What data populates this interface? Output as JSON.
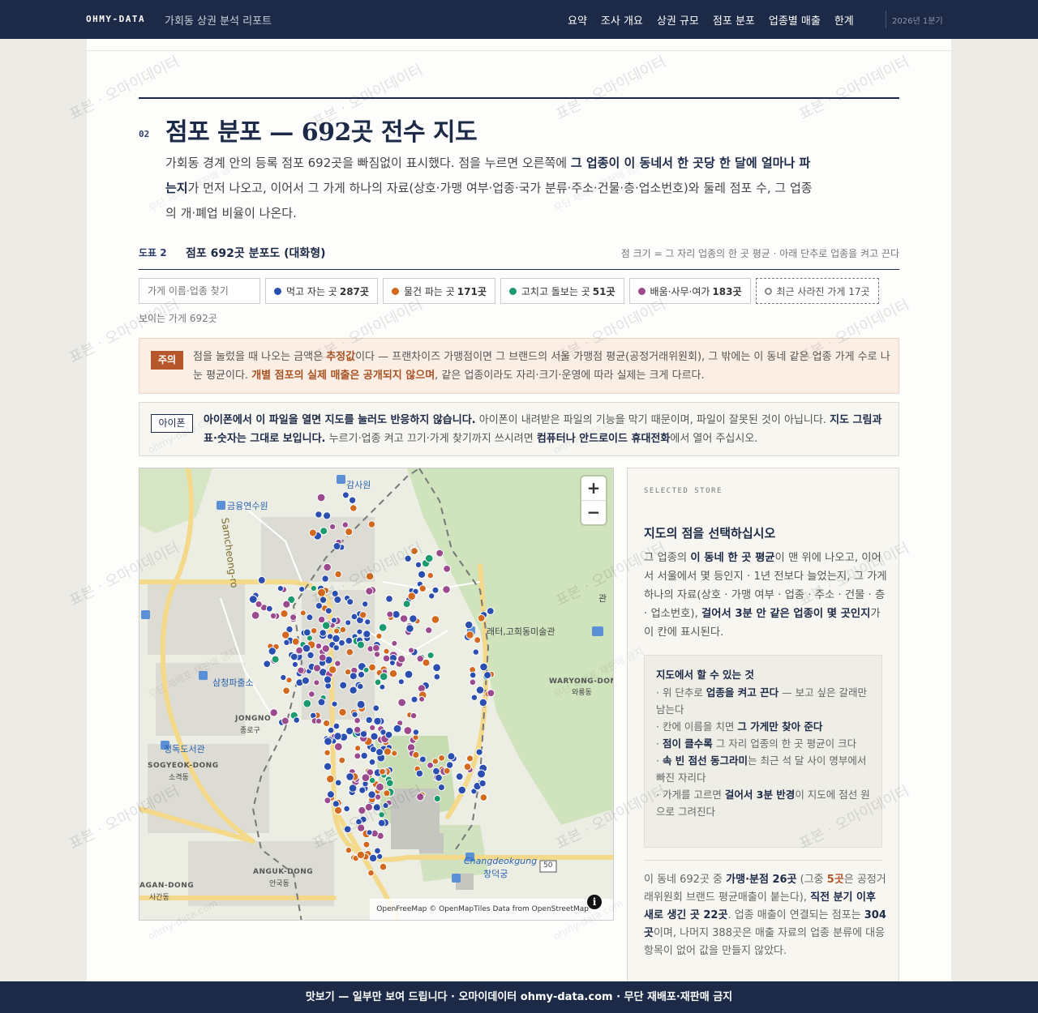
{
  "header": {
    "brand": "OHMY-DATA",
    "report_title": "가회동 상권 분석 리포트",
    "nav": [
      "요약",
      "조사 개요",
      "상권 규모",
      "점포 분포",
      "업종별 매출",
      "한계"
    ],
    "period": "2026년 1분기"
  },
  "section": {
    "number": "02",
    "title": "점포 분포 — 692곳 전수 지도",
    "desc_1": "가회동 경계 안의 등록 점포 692곳을 빠짐없이 표시했다. 점을 누르면 오른쪽에 ",
    "desc_b1": "그 업종이 이 동네서 한 곳당 한 달에 얼마나 파는지",
    "desc_2": "가 먼저 나오고, 이어서 그 가게 하나의 자료(상호·가맹 여부·업종·국가 분류·주소·건물·층·업소번호)와 둘레 점포 수, 그 업종의 개·폐업 비율이 나온다."
  },
  "figure": {
    "label": "도표 2",
    "title": "점포 692곳 분포도 (대화형)",
    "note": "점 크기 = 그 자리 업종의 한 곳 평균 · 아래 단추로 업종을 켜고 끈다"
  },
  "controls": {
    "search_placeholder": "가게 이름·업종 찾기",
    "chips": [
      {
        "label": "먹고 자는 곳",
        "count": "287곳",
        "color": "#2a4fb0"
      },
      {
        "label": "물건 파는 곳",
        "count": "171곳",
        "color": "#d2691e"
      },
      {
        "label": "고치고 돌보는 곳",
        "count": "51곳",
        "color": "#1b9a6e"
      },
      {
        "label": "배움·사무·여가",
        "count": "183곳",
        "color": "#9b4a8e"
      }
    ],
    "closed_label": "최근 사라진 가게 17곳",
    "visible_count": "보이는 가게 692곳"
  },
  "warning": {
    "tag": "주의",
    "t1": "점을 눌렀을 때 나오는 금액은 ",
    "b1": "추정값",
    "t2": "이다 — 프랜차이즈 가맹점이면 그 브랜드의 서울 가맹점 평균(공정거래위원회), 그 밖에는 이 동네 같은 업종 가게 수로 나눈 평균이다. ",
    "b2": "개별 점포의 실제 매출은 공개되지 않으며",
    "t3": ", 같은 업종이라도 자리·크기·운영에 따라 실제는 크게 다르다."
  },
  "ios": {
    "tag": "아이폰",
    "b1": "아이폰에서 이 파일을 열면 지도를 눌러도 반응하지 않습니다.",
    "t1": " 아이폰이 내려받은 파일의 기능을 막기 때문이며, 파일이 잘못된 것이 아닙니다. ",
    "b2": "지도 그림과 표·숫자는 그대로 보입니다.",
    "t2": " 누르기·업종 켜고 끄기·가게 찾기까지 쓰시려면 ",
    "b3": "컴퓨터나 안드로이드 휴대전화",
    "t3": "에서 열어 주십시오."
  },
  "map": {
    "zoom_in": "+",
    "zoom_out": "−",
    "attribution": "OpenFreeMap © OpenMapTiles Data from OpenStreetMap",
    "info": "i",
    "labels": {
      "gamsawon": "감사원",
      "geumyung": "금융연수원",
      "road": "Samcheong-ro",
      "samcheong_police": "삼청파출소",
      "jongno_en": "JONGNO",
      "jongno_ko": "종로구",
      "library": "정독도서관",
      "sogyeok_en": "SOGYEOK-DONG",
      "sogyeok_ko": "소격동",
      "anguk_en": "ANGUK-DONG",
      "anguk_ko": "안국동",
      "agan_en": "AGAN-DONG",
      "agan_ko": "사간동",
      "gohui": "래터,고희동미술관",
      "waryong_en": "WARYONG-DON",
      "waryong_ko": "와룡동",
      "changdeok_en": "Changdeokgung",
      "changdeok_ko": "창덕궁",
      "gwan": "관",
      "route": "50"
    }
  },
  "panel": {
    "eyebrow": "SELECTED STORE",
    "title": "지도의 점을 선택하십시오",
    "d1": "그 업종의 ",
    "db1": "이 동네 한 곳 평균",
    "d2": "이 맨 위에 나오고, 이어서 서울에서 몇 등인지 · 1년 전보다 늘었는지, 그 가게 하나의 자료(상호 · 가맹 여부 · 업종 · 주소 · 건물 · 층 · 업소번호), ",
    "db2": "걸어서 3분 안 같은 업종이 몇 곳인지",
    "d3": "가 이 칸에 표시된다.",
    "tips_title": "지도에서 할 수 있는 것",
    "tip1a": "· 위 단추로 ",
    "tip1b": "업종을 켜고 끈다",
    "tip1c": " — 보고 싶은 갈래만 남는다",
    "tip2a": "· 칸에 이름을 치면 ",
    "tip2b": "그 가게만 찾아 준다",
    "tip3a": "· ",
    "tip3b": "점이 클수록",
    "tip3c": " 그 자리 업종의 한 곳 평균이 크다",
    "tip4a": "· ",
    "tip4b": "속 빈 점선 동그라미",
    "tip4c": "는 최근 석 달 사이 명부에서 빠진 자리다",
    "tip5a": "· 가게를 고르면 ",
    "tip5b": "걸어서 3분 반경",
    "tip5c": "이 지도에 점선 원으로 그려진다",
    "s1": "이 동네 692곳 중 ",
    "sb1": "가맹·분점 26곳",
    "s2": " (그중 ",
    "sb2": "5곳",
    "s3": "은 공정거래위원회 브랜드 평균매출이 붙는다), ",
    "sb3": "직전 분기 이후 새로 생긴 곳 22곳",
    "s4": ". 업종 매출이 연결되는 점포는 ",
    "sb4": "304곳",
    "s5": "이며, 나머지 388곳은 매출 자료의 업종 분류에 대응 항목이 없어 값을 만들지 않았다."
  },
  "footer": "맛보기 — 일부만 보여 드립니다 · 오마이데이터 ohmy-data.com · 무단 재배포·재판매 금지",
  "watermark": {
    "main": "표본 · 오마이데이터",
    "sub": "무단 재배포·재판매 금지",
    "site": "ohmy-data.com"
  }
}
